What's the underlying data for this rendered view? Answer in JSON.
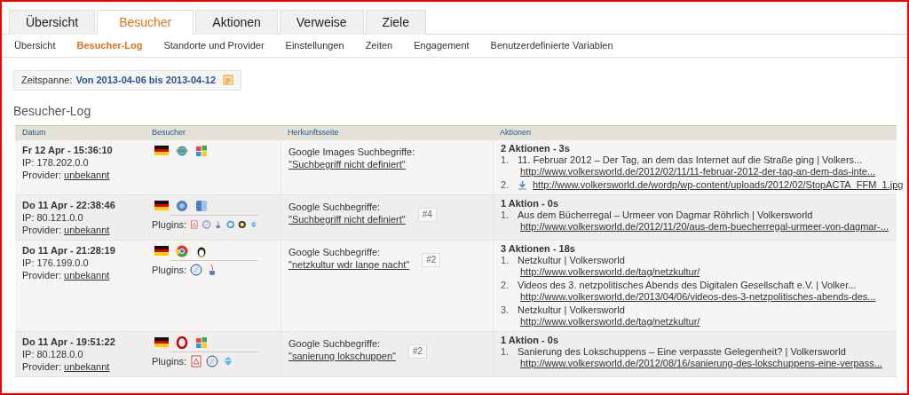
{
  "main_tabs": [
    {
      "label": "Übersicht",
      "selected": false
    },
    {
      "label": "Besucher",
      "selected": true
    },
    {
      "label": "Aktionen",
      "selected": false
    },
    {
      "label": "Verweise",
      "selected": false
    },
    {
      "label": "Ziele",
      "selected": false
    }
  ],
  "sub_nav": [
    {
      "label": "Übersicht",
      "selected": false
    },
    {
      "label": "Besucher-Log",
      "selected": true
    },
    {
      "label": "Standorte und Provider",
      "selected": false
    },
    {
      "label": "Einstellungen",
      "selected": false
    },
    {
      "label": "Zeiten",
      "selected": false
    },
    {
      "label": "Engagement",
      "selected": false
    },
    {
      "label": "Benutzerdefinierte Variablen",
      "selected": false
    }
  ],
  "period": {
    "label": "Zeitspanne:",
    "value": "Von 2013-04-06 bis 2013-04-12"
  },
  "heading": "Besucher-Log",
  "table": {
    "columns": [
      "Datum",
      "Besucher",
      "Herkunftsseite",
      "Aktionen"
    ],
    "rows": [
      {
        "date": "Fr 12 Apr - 15:36:10",
        "ip": "IP: 178.202.0.0",
        "provider_label": "Provider:",
        "provider": "unbekannt",
        "referrer_label": "Google Images Suchbegriffe:",
        "referrer": "\"Suchbegriff nicht definiert\"",
        "actions_summary": "2 Aktionen - 3s",
        "actions": [
          {
            "kind": "page",
            "number": "1.",
            "title": "11. Februar 2012 – Der Tag, an dem das Internet auf die Straße ging | Volkers...",
            "url": "http://www.volkersworld.de/2012/02/11/11-februar-2012-der-tag-an-dem-das-inte..."
          },
          {
            "kind": "download",
            "number": "2.",
            "url": "http://www.volkersworld.de/wordp/wp-content/uploads/2012/02/StopACTA_FFM_1.jpg"
          }
        ]
      },
      {
        "date": "Do 11 Apr - 22:38:46",
        "ip": "IP: 80.121.0.0",
        "provider_label": "Provider:",
        "provider": "unbekannt",
        "plugins_label": "Plugins:",
        "referrer_label": "Google Suchbegriffe:",
        "referrer": "\"Suchbegriff nicht definiert\"",
        "rank": "#4",
        "actions_summary": "1 Aktion - 0s",
        "actions": [
          {
            "kind": "page",
            "number": "1.",
            "title": "Aus dem Bücherregal – Urmeer von Dagmar Röhrlich | Volkersworld",
            "url": "http://www.volkersworld.de/2012/11/20/aus-dem-buecherregal-urmeer-von-dagmar-..."
          }
        ]
      },
      {
        "date": "Do 11 Apr - 21:28:19",
        "ip": "IP: 176.199.0.0",
        "provider_label": "Provider:",
        "provider": "unbekannt",
        "plugins_label": "Plugins:",
        "referrer_label": "Google Suchbegriffe:",
        "referrer": "\"netzkultur wdr lange nacht\"",
        "rank": "#2",
        "actions_summary": "3 Aktionen - 18s",
        "actions": [
          {
            "kind": "page",
            "number": "1.",
            "title": "Netzkultur | Volkersworld",
            "url": "http://www.volkersworld.de/tag/netzkultur/"
          },
          {
            "kind": "page",
            "number": "2.",
            "title": "Videos des 3. netzpolitisches Abends des Digitalen Gesellschaft e.V. | Volker...",
            "url": "http://www.volkersworld.de/2013/04/06/videos-des-3-netzpolitisches-abends-des..."
          },
          {
            "kind": "page",
            "number": "3.",
            "title": "Netzkultur | Volkersworld",
            "url": "http://www.volkersworld.de/tag/netzkultur/"
          }
        ]
      },
      {
        "date": "Do 11 Apr - 19:51:22",
        "ip": "IP: 80.128.0.0",
        "provider_label": "Provider:",
        "provider": "unbekannt",
        "plugins_label": "Plugins:",
        "referrer_label": "Google Suchbegriffe:",
        "referrer": "\"sanierung lokschuppen\"",
        "rank": "#2",
        "actions_summary": "1 Aktion - 0s",
        "actions": [
          {
            "kind": "page",
            "number": "1.",
            "title": "Sanierung des Lokschuppens – Eine verpasste Gelegenheit? | Volkersworld",
            "url": "http://www.volkersworld.de/2012/08/16/sanierung-des-lokschuppens-eine-verpass..."
          }
        ]
      }
    ]
  }
}
